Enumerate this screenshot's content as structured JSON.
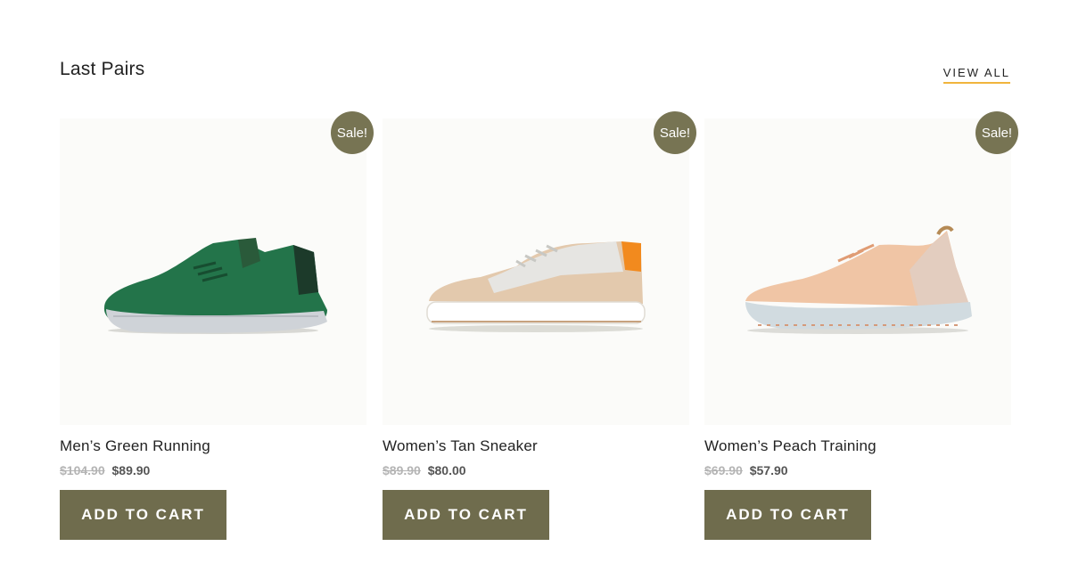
{
  "section": {
    "title": "Last Pairs",
    "view_all": "VIEW ALL"
  },
  "colors": {
    "accent": "#6f6c4d",
    "badge": "#777453",
    "underline": "#f0b43c"
  },
  "products": [
    {
      "name": "Men’s Green Running",
      "old_price": "$104.90",
      "price": "$89.90",
      "badge": "Sale!",
      "button": "ADD TO CART",
      "image": "green-running-shoe"
    },
    {
      "name": "Women’s Tan Sneaker",
      "old_price": "$89.90",
      "price": "$80.00",
      "badge": "Sale!",
      "button": "ADD TO CART",
      "image": "tan-sneaker"
    },
    {
      "name": "Women’s Peach Training",
      "old_price": "$69.90",
      "price": "$57.90",
      "badge": "Sale!",
      "button": "ADD TO CART",
      "image": "peach-training-shoe"
    }
  ]
}
